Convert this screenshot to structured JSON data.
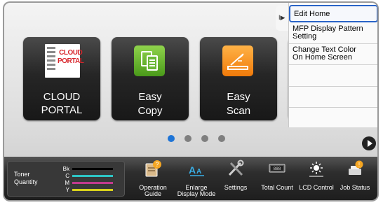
{
  "tiles": [
    {
      "label": "CLOUD PORTAL",
      "logo_text": "CLOUD\nPORTAL",
      "logo_text_l1": "CLOUD",
      "logo_text_l2": "PORTAL"
    },
    {
      "label_l1": "Easy",
      "label_l2": "Copy"
    },
    {
      "label_l1": "Easy",
      "label_l2": "Scan"
    }
  ],
  "menu": {
    "toggle_glyph": "I▶",
    "items": [
      {
        "label": "Edit Home",
        "selected": true
      },
      {
        "label_l1": "MFP Display Pattern",
        "label_l2": "Setting"
      },
      {
        "label_l1": "Change Text Color",
        "label_l2": "On Home Screen"
      },
      {
        "label": ""
      },
      {
        "label": ""
      },
      {
        "label": ""
      }
    ]
  },
  "pager": {
    "pages": 4,
    "current": 1
  },
  "toner": {
    "title_l1": "Toner",
    "title_l2": "Quantity",
    "rows": [
      {
        "key": "Bk",
        "color": "#000000"
      },
      {
        "key": "C",
        "color": "#2ec4c4"
      },
      {
        "key": "M",
        "color": "#c23a8e"
      },
      {
        "key": "Y",
        "color": "#d9d21c"
      }
    ]
  },
  "tools": [
    {
      "label_l1": "Operation",
      "label_l2": "Guide",
      "icon": "operation-guide-icon"
    },
    {
      "label_l1": "Enlarge",
      "label_l2": "Display Mode",
      "icon": "enlarge-display-icon"
    },
    {
      "label_l1": "Settings",
      "label_l2": "",
      "icon": "settings-icon"
    },
    {
      "label_l1": "Total Count",
      "label_l2": "",
      "icon": "total-count-icon"
    },
    {
      "label_l1": "LCD Control",
      "label_l2": "",
      "icon": "lcd-control-icon"
    },
    {
      "label_l1": "Job Status",
      "label_l2": "",
      "icon": "job-status-icon"
    }
  ],
  "colors": {
    "accent": "#2a64c8",
    "pager_active": "#1e74d6"
  }
}
